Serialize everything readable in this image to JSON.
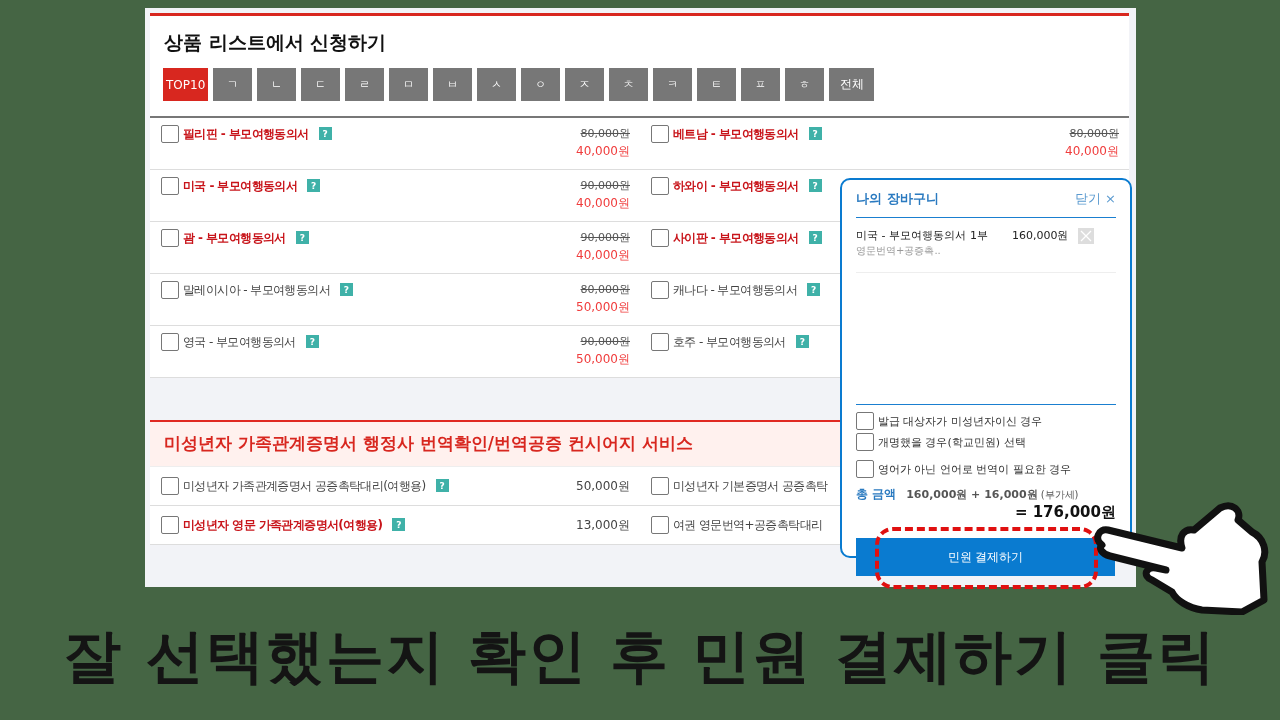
{
  "title": "상품 리스트에서 신청하기",
  "letter_tabs": [
    {
      "label": "TOP10",
      "selected": true
    },
    {
      "label": "ㄱ",
      "selected": false
    },
    {
      "label": "ㄴ",
      "selected": false
    },
    {
      "label": "ㄷ",
      "selected": false
    },
    {
      "label": "ㄹ",
      "selected": false
    },
    {
      "label": "ㅁ",
      "selected": false
    },
    {
      "label": "ㅂ",
      "selected": false
    },
    {
      "label": "ㅅ",
      "selected": false
    },
    {
      "label": "ㅇ",
      "selected": false
    },
    {
      "label": "ㅈ",
      "selected": false
    },
    {
      "label": "ㅊ",
      "selected": false
    },
    {
      "label": "ㅋ",
      "selected": false
    },
    {
      "label": "ㅌ",
      "selected": false
    },
    {
      "label": "ㅍ",
      "selected": false
    },
    {
      "label": "ㅎ",
      "selected": false
    },
    {
      "label": "전체",
      "selected": false
    }
  ],
  "products": [
    [
      {
        "name": "필리핀 - 부모여행동의서",
        "hot": true,
        "checked": false,
        "help": "?",
        "old_price": "80,000원",
        "price": "40,000원"
      },
      {
        "name": "베트남 - 부모여행동의서",
        "hot": true,
        "checked": false,
        "help": "?",
        "old_price": "80,000원",
        "price": "40,000원"
      }
    ],
    [
      {
        "name": "미국 - 부모여행동의서",
        "hot": true,
        "checked": false,
        "help": "?",
        "old_price": "90,000원",
        "price": "40,000원"
      },
      {
        "name": "하와이 - 부모여행동의서",
        "hot": true,
        "checked": false,
        "help": "?"
      }
    ],
    [
      {
        "name": "괌 - 부모여행동의서",
        "hot": true,
        "checked": false,
        "help": "?",
        "old_price": "90,000원",
        "price": "40,000원"
      },
      {
        "name": "사이판 - 부모여행동의서",
        "hot": true,
        "checked": false,
        "help": "?"
      }
    ],
    [
      {
        "name": "말레이시아 - 부모여행동의서",
        "hot": false,
        "checked": false,
        "help": "?",
        "old_price": "80,000원",
        "price": "50,000원"
      },
      {
        "name": "캐나다 - 부모여행동의서",
        "hot": false,
        "checked": false,
        "help": "?"
      }
    ],
    [
      {
        "name": "영국 - 부모여행동의서",
        "hot": false,
        "checked": false,
        "help": "?",
        "old_price": "90,000원",
        "price": "50,000원"
      },
      {
        "name": "호주 - 부모여행동의서",
        "hot": false,
        "checked": false,
        "help": "?"
      }
    ]
  ],
  "section": {
    "title": "미성년자 가족관계증명서 행정사 번역확인/번역공증 컨시어지 서비스",
    "rows": [
      [
        {
          "name": "미성년자 가족관계증명서 공증촉탁대리(여행용)",
          "hot": false,
          "checked": false,
          "help": "?",
          "price": "50,000원"
        },
        {
          "name": "미성년자 기본증명서 공증촉탁",
          "hot": false,
          "checked": false
        }
      ],
      [
        {
          "name": "미성년자 영문 가족관계증명서(여행용)",
          "hot": true,
          "checked": false,
          "help": "?",
          "price": "13,000원"
        },
        {
          "name": "여권 영문번역+공증촉탁대리",
          "hot": false,
          "checked": false
        }
      ]
    ]
  },
  "cart": {
    "title": "나의 장바구니",
    "close": "닫기 ×",
    "items": [
      {
        "name": "미국 - 부모여행동의서",
        "qty": "1부",
        "price": "160,000원",
        "option": "영문번역+공증촉.."
      }
    ],
    "options": [
      {
        "label": "발급 대상자가 미성년자이신 경우",
        "checked": false
      },
      {
        "label": "개명했을 경우(학교민원) 선택",
        "checked": false
      },
      {
        "label": "영어가 아닌 언어로 번역이 필요한 경우",
        "checked": false
      }
    ],
    "total_label": "총 금액",
    "total_calc": "160,000원 + 16,000원",
    "vat": "(부가세)",
    "total": "= 176,000원",
    "pay_button": "민원 결제하기"
  },
  "caption": "잘 선택했는지 확인 후 민원 결제하기 클릭"
}
